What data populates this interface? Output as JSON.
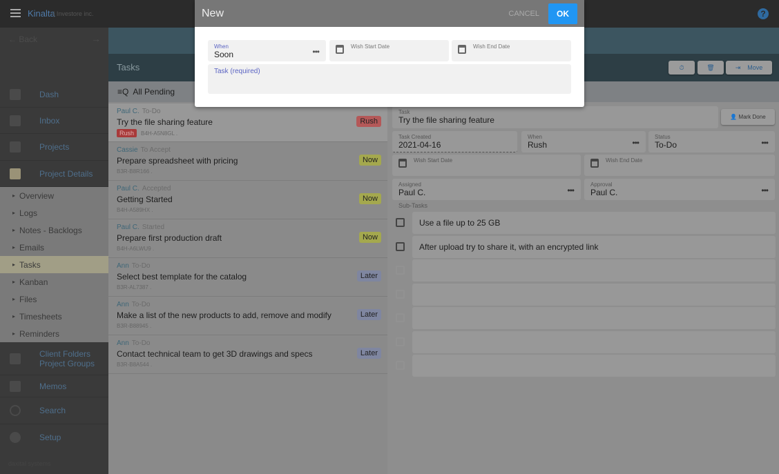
{
  "app": {
    "brand": "Kinalta",
    "org": "| Investore inc.",
    "back": "Back",
    "footer": "daxital systems"
  },
  "sidebar": {
    "items": [
      "Dash",
      "Inbox",
      "Projects",
      "Project Details"
    ],
    "sub": [
      "Overview",
      "Logs",
      "Notes - Backlogs",
      "Emails",
      "Tasks",
      "Kanban",
      "Files",
      "Timesheets",
      "Reminders"
    ],
    "folders1": "Client Folders",
    "folders2": "Project Groups",
    "memos": "Memos",
    "search": "Search",
    "setup": "Setup"
  },
  "header": {
    "title": "Tasks",
    "move": "Move",
    "filter": "All Pending"
  },
  "tasks": [
    {
      "who": "Paul C.",
      "status": "To-Do",
      "title": "Try the file sharing feature",
      "code": "B4H-A5N8GL .",
      "when": "Rush",
      "tag": "Rush"
    },
    {
      "who": "Cassie",
      "status": "To Accept",
      "title": "Prepare spreadsheet with pricing",
      "code": "B3R-B8R166 .",
      "when": "Now"
    },
    {
      "who": "Paul C.",
      "status": "Accepted",
      "title": "Getting Started",
      "code": "B4H-A589HX .",
      "when": "Now"
    },
    {
      "who": "Paul C.",
      "status": "Started",
      "title": "Prepare first production draft",
      "code": "B4H-A6LWU9 .",
      "when": "Now"
    },
    {
      "who": "Ann",
      "status": "To-Do",
      "title": "Select best template for the catalog",
      "code": "B3R-AL7387 .",
      "when": "Later"
    },
    {
      "who": "Ann",
      "status": "To-Do",
      "title": "Make a list of the new products to add, remove and modify",
      "code": "B3R-B88945 .",
      "when": "Later"
    },
    {
      "who": "Ann",
      "status": "To-Do",
      "title": "Contact technical team to get 3D drawings and specs",
      "code": "B3R-B8A544 .",
      "when": "Later"
    }
  ],
  "colors": {
    "Rush": "#b45858",
    "Now": "#a4a84e",
    "Later": "#7f86a0",
    "ok": "#2196f3"
  },
  "detail": {
    "task_label": "Task",
    "task": "Try the file sharing feature",
    "mark_done": "Mark Done",
    "created_label": "Task Created",
    "created": "2021-04-16",
    "when_label": "When",
    "when": "Rush",
    "status_label": "Status",
    "status": "To-Do",
    "wsd": "Wish Start Date",
    "wed": "Wish End Date",
    "assigned_label": "Assigned",
    "assigned": "Paul C.",
    "approval_label": "Approval",
    "approval": "Paul C.",
    "subtasks_label": "Sub-Tasks",
    "subtasks": [
      "Use a file up to 25 GB",
      "After upload try to share it, with an encrypted link"
    ]
  },
  "dialog": {
    "title": "New",
    "cancel": "CANCEL",
    "ok": "OK",
    "when_label": "When",
    "when": "Soon",
    "wsd": "Wish Start Date",
    "wed": "Wish End Date",
    "task_label": "Task (required)"
  }
}
